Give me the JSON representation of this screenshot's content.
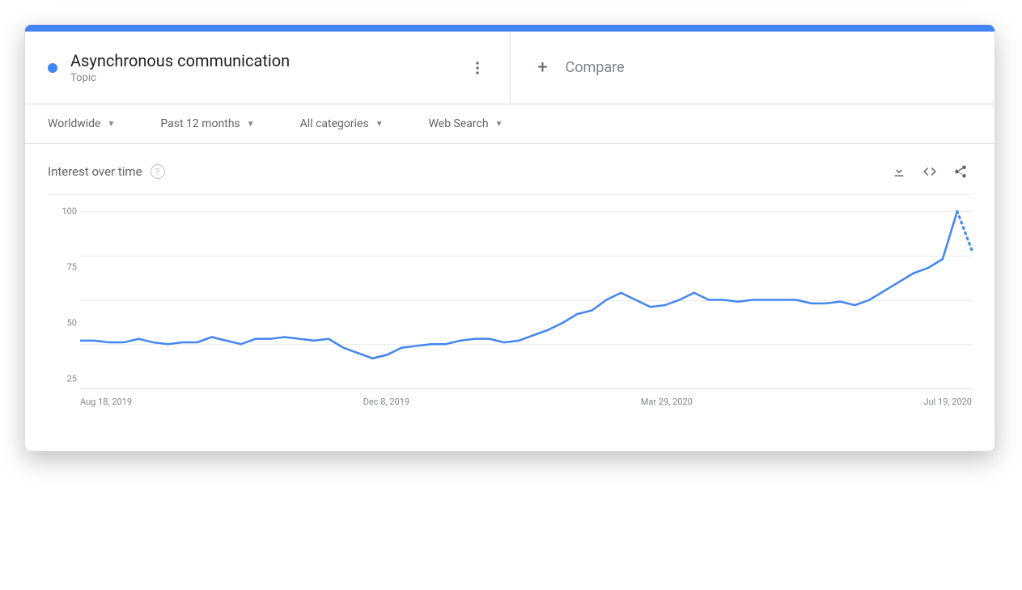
{
  "colors": {
    "accent": "#4285f4"
  },
  "topic": {
    "title": "Asynchronous communication",
    "subtitle": "Topic"
  },
  "compare": {
    "label": "Compare"
  },
  "filters": {
    "region": "Worldwide",
    "time": "Past 12 months",
    "category": "All categories",
    "search_type": "Web Search"
  },
  "chart": {
    "title": "Interest over time",
    "y_ticks": [
      "100",
      "75",
      "50",
      "25"
    ],
    "x_ticks": [
      "Aug 18, 2019",
      "Dec 8, 2019",
      "Mar 29, 2020",
      "Jul 19, 2020"
    ]
  },
  "chart_data": {
    "type": "line",
    "title": "Interest over time",
    "xlabel": "",
    "ylabel": "",
    "ylim": [
      0,
      100
    ],
    "x_tick_labels": [
      "Aug 18, 2019",
      "Dec 8, 2019",
      "Mar 29, 2020",
      "Jul 19, 2020"
    ],
    "series": [
      {
        "name": "Asynchronous communication",
        "values": [
          27,
          27,
          26,
          26,
          28,
          26,
          25,
          26,
          26,
          29,
          27,
          25,
          28,
          28,
          29,
          28,
          27,
          28,
          23,
          20,
          17,
          19,
          23,
          24,
          25,
          25,
          27,
          28,
          28,
          26,
          27,
          30,
          33,
          37,
          42,
          44,
          50,
          54,
          50,
          46,
          47,
          50,
          54,
          50,
          50,
          49,
          50,
          50,
          50,
          50,
          48,
          48,
          49,
          47,
          50,
          55,
          60,
          65,
          68,
          73,
          100
        ],
        "projection": [
          100,
          78
        ]
      }
    ]
  }
}
